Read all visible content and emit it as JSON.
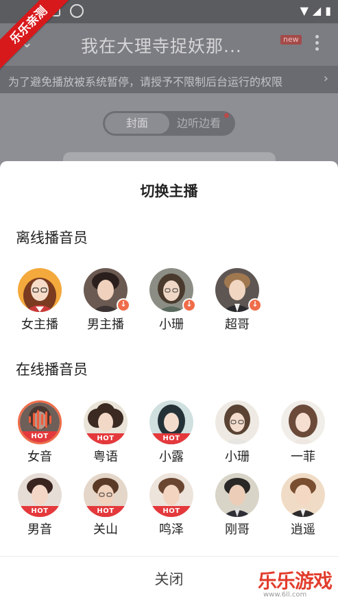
{
  "ribbon": {
    "text": "乐乐亲测"
  },
  "app": {
    "title": "我在大理寺捉妖那...",
    "new_badge": "new",
    "notice": "为了避免播放被系统暂停，请授予不限制后台运行的权限",
    "tabs": [
      "封面",
      "边听边看"
    ]
  },
  "sheet": {
    "title": "切换主播",
    "offline_section": "离线播音员",
    "online_section": "在线播音员",
    "hot_label": "HOT",
    "close": "关闭",
    "offline": [
      {
        "name": "女主播"
      },
      {
        "name": "男主播"
      },
      {
        "name": "小珊"
      },
      {
        "name": "超哥"
      }
    ],
    "online_row1": [
      {
        "name": "女音"
      },
      {
        "name": "粤语"
      },
      {
        "name": "小露"
      },
      {
        "name": "小珊"
      },
      {
        "name": "一菲"
      }
    ],
    "online_row2": [
      {
        "name": "男音"
      },
      {
        "name": "关山"
      },
      {
        "name": "鸣泽"
      },
      {
        "name": "刚哥"
      },
      {
        "name": "逍遥"
      }
    ]
  },
  "watermark": {
    "title": "乐乐游戏",
    "url": "www.6ll.com"
  },
  "colors": {
    "accent": "#ef6d4a",
    "hot": "#e4393c",
    "ribbon": "#d8191c"
  }
}
